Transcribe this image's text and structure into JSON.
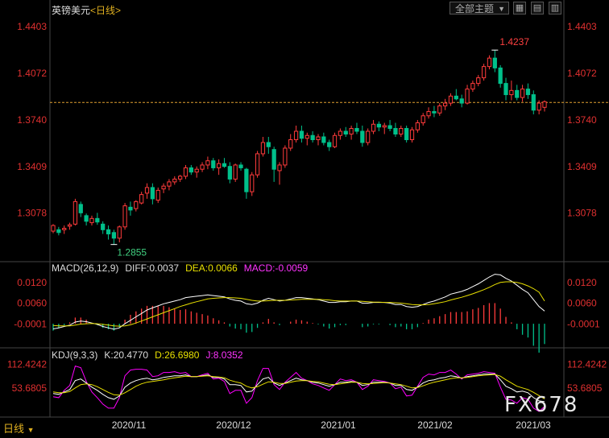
{
  "header": {
    "symbol_name": "英镑美元",
    "period_label": "<日线>",
    "theme_dropdown": "全部主题",
    "bottom_period": "日线",
    "watermark": "FX678"
  },
  "icons": [
    "chevron-down-icon",
    "grid-icon",
    "layout-icon",
    "dual-pane-icon"
  ],
  "colors": {
    "up": "#ff3b3b",
    "down": "#00c08b",
    "ma_white": "#ffffff",
    "ma_yellow": "#e8e000",
    "j_line": "#ff00ff",
    "axis_text": "#e03030",
    "current_price_line": "#e0a030",
    "grid": "#2a2a2a"
  },
  "chart_data": [
    {
      "type": "candlestick",
      "title": "英镑美元<日线>",
      "y_ticks": [
        "1.4403",
        "1.4072",
        "1.3740",
        "1.3409",
        "1.3078"
      ],
      "ylim": [
        1.275,
        1.449
      ],
      "x_ticks": [
        "2020/11",
        "2020/12",
        "2021/01",
        "2021/02",
        "2021/03"
      ],
      "annotations": {
        "high": "1.4237",
        "low": "1.2855"
      },
      "current_price": 1.3865,
      "candles": [
        [
          1.295,
          1.3,
          1.2935,
          1.299
        ],
        [
          1.296,
          1.298,
          1.292,
          1.294
        ],
        [
          1.296,
          1.299,
          1.293,
          1.297
        ],
        [
          1.2985,
          1.301,
          1.296,
          1.2995
        ],
        [
          1.3,
          1.318,
          1.299,
          1.316
        ],
        [
          1.314,
          1.316,
          1.305,
          1.308
        ],
        [
          1.306,
          1.3075,
          1.299,
          1.302
        ],
        [
          1.301,
          1.306,
          1.299,
          1.304
        ],
        [
          1.304,
          1.308,
          1.2995,
          1.3015
        ],
        [
          1.3,
          1.302,
          1.293,
          1.296
        ],
        [
          1.296,
          1.299,
          1.289,
          1.293
        ],
        [
          1.294,
          1.296,
          1.2855,
          1.29
        ],
        [
          1.29,
          1.299,
          1.287,
          1.298
        ],
        [
          1.298,
          1.315,
          1.296,
          1.313
        ],
        [
          1.312,
          1.316,
          1.306,
          1.31
        ],
        [
          1.311,
          1.317,
          1.309,
          1.316
        ],
        [
          1.315,
          1.323,
          1.314,
          1.321
        ],
        [
          1.322,
          1.329,
          1.318,
          1.326
        ],
        [
          1.326,
          1.329,
          1.314,
          1.318
        ],
        [
          1.317,
          1.326,
          1.315,
          1.324
        ],
        [
          1.325,
          1.329,
          1.322,
          1.327
        ],
        [
          1.327,
          1.332,
          1.324,
          1.33
        ],
        [
          1.33,
          1.334,
          1.328,
          1.332
        ],
        [
          1.332,
          1.335,
          1.33,
          1.334
        ],
        [
          1.334,
          1.342,
          1.332,
          1.34
        ],
        [
          1.34,
          1.342,
          1.335,
          1.337
        ],
        [
          1.337,
          1.341,
          1.333,
          1.339
        ],
        [
          1.339,
          1.344,
          1.337,
          1.342
        ],
        [
          1.342,
          1.348,
          1.339,
          1.345
        ],
        [
          1.345,
          1.347,
          1.338,
          1.34
        ],
        [
          1.34,
          1.346,
          1.335,
          1.343
        ],
        [
          1.343,
          1.347,
          1.34,
          1.341
        ],
        [
          1.341,
          1.344,
          1.329,
          1.332
        ],
        [
          1.332,
          1.343,
          1.33,
          1.342
        ],
        [
          1.342,
          1.344,
          1.338,
          1.34
        ],
        [
          1.339,
          1.34,
          1.318,
          1.323
        ],
        [
          1.323,
          1.337,
          1.32,
          1.335
        ],
        [
          1.335,
          1.352,
          1.333,
          1.35
        ],
        [
          1.35,
          1.362,
          1.348,
          1.358
        ],
        [
          1.358,
          1.362,
          1.35,
          1.355
        ],
        [
          1.353,
          1.355,
          1.33,
          1.339
        ],
        [
          1.338,
          1.344,
          1.328,
          1.342
        ],
        [
          1.342,
          1.356,
          1.34,
          1.354
        ],
        [
          1.354,
          1.364,
          1.352,
          1.36
        ],
        [
          1.36,
          1.37,
          1.358,
          1.366
        ],
        [
          1.366,
          1.37,
          1.358,
          1.361
        ],
        [
          1.361,
          1.365,
          1.356,
          1.363
        ],
        [
          1.363,
          1.366,
          1.358,
          1.36
        ],
        [
          1.36,
          1.364,
          1.356,
          1.362
        ],
        [
          1.362,
          1.365,
          1.356,
          1.358
        ],
        [
          1.358,
          1.36,
          1.352,
          1.355
        ],
        [
          1.355,
          1.365,
          1.354,
          1.363
        ],
        [
          1.363,
          1.368,
          1.36,
          1.366
        ],
        [
          1.366,
          1.369,
          1.362,
          1.364
        ],
        [
          1.364,
          1.37,
          1.36,
          1.368
        ],
        [
          1.368,
          1.372,
          1.364,
          1.366
        ],
        [
          1.366,
          1.37,
          1.355,
          1.358
        ],
        [
          1.358,
          1.368,
          1.356,
          1.366
        ],
        [
          1.366,
          1.374,
          1.364,
          1.371
        ],
        [
          1.371,
          1.373,
          1.366,
          1.369
        ],
        [
          1.369,
          1.372,
          1.364,
          1.37
        ],
        [
          1.37,
          1.374,
          1.366,
          1.368
        ],
        [
          1.368,
          1.372,
          1.362,
          1.364
        ],
        [
          1.364,
          1.37,
          1.362,
          1.368
        ],
        [
          1.368,
          1.37,
          1.358,
          1.36
        ],
        [
          1.36,
          1.369,
          1.358,
          1.367
        ],
        [
          1.367,
          1.374,
          1.365,
          1.372
        ],
        [
          1.372,
          1.379,
          1.37,
          1.377
        ],
        [
          1.377,
          1.383,
          1.375,
          1.38
        ],
        [
          1.38,
          1.384,
          1.376,
          1.379
        ],
        [
          1.379,
          1.386,
          1.377,
          1.384
        ],
        [
          1.384,
          1.389,
          1.381,
          1.386
        ],
        [
          1.386,
          1.393,
          1.384,
          1.391
        ],
        [
          1.391,
          1.396,
          1.388,
          1.389
        ],
        [
          1.389,
          1.392,
          1.383,
          1.386
        ],
        [
          1.386,
          1.399,
          1.385,
          1.396
        ],
        [
          1.396,
          1.402,
          1.394,
          1.4
        ],
        [
          1.4,
          1.406,
          1.398,
          1.404
        ],
        [
          1.404,
          1.414,
          1.402,
          1.412
        ],
        [
          1.412,
          1.42,
          1.41,
          1.418
        ],
        [
          1.418,
          1.4237,
          1.408,
          1.411
        ],
        [
          1.411,
          1.413,
          1.397,
          1.4
        ],
        [
          1.4,
          1.404,
          1.388,
          1.392
        ],
        [
          1.392,
          1.402,
          1.388,
          1.395
        ],
        [
          1.395,
          1.399,
          1.388,
          1.39
        ],
        [
          1.39,
          1.399,
          1.387,
          1.396
        ],
        [
          1.396,
          1.4,
          1.389,
          1.392
        ],
        [
          1.392,
          1.395,
          1.378,
          1.381
        ],
        [
          1.381,
          1.388,
          1.378,
          1.386
        ],
        [
          1.383,
          1.388,
          1.38,
          1.387
        ]
      ]
    },
    {
      "type": "line+histogram",
      "label": "MACD(26,12,9)",
      "values_text": {
        "diff": "DIFF:0.0037",
        "dea": "DEA:0.0066",
        "macd": "MACD:-0.0059"
      },
      "y_ticks": [
        "0.0120",
        "0.0060",
        "-0.0001"
      ],
      "ylim": [
        -0.007,
        0.015
      ],
      "diff": [
        -0.0015,
        -0.0012,
        -0.0008,
        -0.0004,
        0.0005,
        0.0008,
        0.0006,
        0.0002,
        -0.0002,
        -0.0008,
        -0.0012,
        -0.0016,
        -0.0012,
        0.0,
        0.001,
        0.002,
        0.003,
        0.004,
        0.0046,
        0.0052,
        0.0058,
        0.0062,
        0.0066,
        0.007,
        0.0076,
        0.0078,
        0.008,
        0.0082,
        0.0084,
        0.0082,
        0.008,
        0.0078,
        0.0072,
        0.0068,
        0.0066,
        0.0058,
        0.0056,
        0.006,
        0.0068,
        0.0074,
        0.007,
        0.0066,
        0.0068,
        0.0072,
        0.0076,
        0.0076,
        0.0074,
        0.0072,
        0.007,
        0.0066,
        0.0062,
        0.0062,
        0.0064,
        0.0064,
        0.0066,
        0.0066,
        0.006,
        0.006,
        0.0062,
        0.0062,
        0.0062,
        0.006,
        0.0056,
        0.0056,
        0.005,
        0.0048,
        0.005,
        0.0056,
        0.0062,
        0.0066,
        0.0072,
        0.0078,
        0.0086,
        0.009,
        0.0094,
        0.01,
        0.0108,
        0.0116,
        0.0126,
        0.0136,
        0.0144,
        0.0142,
        0.0132,
        0.0124,
        0.0112,
        0.01,
        0.009,
        0.007,
        0.005,
        0.0037
      ],
      "dea": [
        -0.0005,
        -0.0006,
        -0.0006,
        -0.0006,
        -0.0004,
        -0.0001,
        0.0,
        0.0001,
        0.0,
        -0.0002,
        -0.0004,
        -0.0006,
        -0.0007,
        -0.0006,
        -0.0003,
        0.0002,
        0.0008,
        0.0014,
        0.002,
        0.0026,
        0.0032,
        0.0038,
        0.0044,
        0.005,
        0.0055,
        0.006,
        0.0064,
        0.0068,
        0.0072,
        0.0074,
        0.0075,
        0.0076,
        0.0076,
        0.0075,
        0.0074,
        0.0071,
        0.0068,
        0.0066,
        0.0066,
        0.0067,
        0.0068,
        0.0068,
        0.0068,
        0.0069,
        0.007,
        0.0071,
        0.0071,
        0.0071,
        0.0071,
        0.007,
        0.0069,
        0.0067,
        0.0066,
        0.0066,
        0.0066,
        0.0066,
        0.0065,
        0.0064,
        0.0063,
        0.0063,
        0.0062,
        0.0062,
        0.0061,
        0.006,
        0.0058,
        0.0056,
        0.0055,
        0.0055,
        0.0056,
        0.0058,
        0.0061,
        0.0064,
        0.0069,
        0.0073,
        0.0077,
        0.0082,
        0.0087,
        0.0093,
        0.0099,
        0.0106,
        0.0114,
        0.012,
        0.0122,
        0.0122,
        0.012,
        0.0116,
        0.011,
        0.0102,
        0.0092,
        0.0066
      ],
      "macd": [
        -0.002,
        -0.0012,
        -0.0004,
        0.0004,
        0.0018,
        0.0018,
        0.0012,
        0.0002,
        -0.0004,
        -0.0012,
        -0.0016,
        -0.002,
        -0.001,
        0.0012,
        0.0026,
        0.0036,
        0.0044,
        0.0052,
        0.0052,
        0.0052,
        0.0052,
        0.0048,
        0.0044,
        0.004,
        0.0042,
        0.0036,
        0.0032,
        0.0028,
        0.0024,
        0.0016,
        0.001,
        0.0004,
        -0.0008,
        -0.0014,
        -0.0016,
        -0.0026,
        -0.0024,
        -0.0012,
        0.0004,
        0.0014,
        0.0004,
        -0.0004,
        0.0,
        0.0006,
        0.0012,
        0.001,
        0.0006,
        0.0002,
        -0.0002,
        -0.0008,
        -0.0014,
        -0.001,
        -0.0004,
        -0.0004,
        0.0,
        0.0,
        -0.001,
        -0.0008,
        -0.0002,
        -0.0002,
        0.0,
        -0.0004,
        -0.001,
        -0.0008,
        -0.0016,
        -0.0016,
        -0.001,
        0.0002,
        0.0012,
        0.0016,
        0.0022,
        0.0028,
        0.0034,
        0.0034,
        0.0034,
        0.0036,
        0.0042,
        0.0046,
        0.0054,
        0.006,
        0.006,
        0.0044,
        0.002,
        0.0004,
        -0.0016,
        -0.0032,
        -0.004,
        -0.0064,
        -0.0084,
        -0.0059
      ]
    },
    {
      "type": "line",
      "label": "KDJ(9,3,3)",
      "values_text": {
        "k": "K:20.4770",
        "d": "D:26.6980",
        "j": "J:8.0352"
      },
      "y_ticks": [
        "112.4242",
        "53.6805"
      ],
      "ylim": [
        -10,
        125
      ],
      "k": [
        40,
        38,
        44,
        50,
        72,
        76,
        66,
        56,
        48,
        38,
        30,
        26,
        34,
        56,
        66,
        72,
        76,
        78,
        74,
        76,
        80,
        82,
        84,
        84,
        86,
        82,
        82,
        84,
        86,
        80,
        80,
        76,
        62,
        62,
        60,
        44,
        46,
        62,
        76,
        80,
        66,
        60,
        66,
        72,
        78,
        74,
        72,
        68,
        66,
        62,
        58,
        62,
        68,
        68,
        70,
        68,
        60,
        62,
        68,
        68,
        68,
        66,
        60,
        60,
        50,
        48,
        56,
        66,
        72,
        74,
        78,
        80,
        84,
        82,
        78,
        82,
        84,
        86,
        88,
        88,
        88,
        74,
        58,
        52,
        44,
        46,
        42,
        30,
        22,
        20
      ],
      "d": [
        44,
        42,
        42,
        45,
        54,
        62,
        64,
        62,
        57,
        50,
        43,
        37,
        36,
        42,
        50,
        58,
        64,
        68,
        70,
        72,
        74,
        77,
        79,
        81,
        83,
        82,
        82,
        83,
        84,
        82,
        81,
        79,
        73,
        69,
        66,
        58,
        54,
        57,
        63,
        69,
        68,
        65,
        65,
        68,
        71,
        72,
        72,
        70,
        69,
        66,
        63,
        62,
        64,
        66,
        68,
        68,
        65,
        64,
        65,
        66,
        67,
        66,
        64,
        62,
        58,
        54,
        55,
        59,
        64,
        68,
        71,
        74,
        77,
        79,
        79,
        80,
        82,
        84,
        85,
        86,
        87,
        83,
        74,
        66,
        58,
        54,
        50,
        43,
        35,
        27
      ],
      "j": [
        32,
        30,
        48,
        60,
        108,
        104,
        70,
        44,
        30,
        14,
        4,
        4,
        30,
        84,
        98,
        100,
        100,
        98,
        82,
        84,
        92,
        92,
        94,
        90,
        92,
        82,
        82,
        86,
        90,
        76,
        78,
        70,
        40,
        48,
        48,
        16,
        30,
        72,
        102,
        102,
        62,
        50,
        68,
        80,
        92,
        78,
        72,
        64,
        60,
        54,
        48,
        62,
        76,
        72,
        74,
        68,
        50,
        58,
        74,
        72,
        70,
        66,
        52,
        56,
        34,
        36,
        58,
        80,
        88,
        86,
        92,
        92,
        98,
        88,
        76,
        86,
        88,
        90,
        94,
        92,
        90,
        56,
        26,
        24,
        16,
        30,
        26,
        4,
        -4,
        8
      ]
    }
  ]
}
